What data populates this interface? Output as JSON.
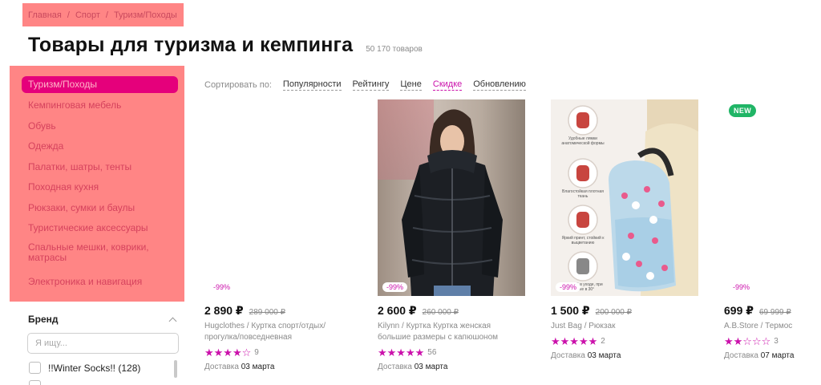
{
  "breadcrumb": {
    "items": [
      "Главная",
      "Спорт",
      "Туризм/Походы"
    ],
    "separator": "/"
  },
  "title": "Товары для туризма и кемпинга",
  "count": "50 170 товаров",
  "sidebar": {
    "categories": [
      "Туризм/Походы",
      "Кемпинговая мебель",
      "Обувь",
      "Одежда",
      "Палатки, шатры, тенты",
      "Походная кухня",
      "Рюкзаки, сумки и баулы",
      "Туристические аксессуары",
      "Спальные мешки, коврики, матрасы",
      "Электроника и навигация"
    ]
  },
  "brand_filter": {
    "title": "Бренд",
    "placeholder": "Я ищу...",
    "items": [
      "!!Winter Socks!! (128)"
    ]
  },
  "sort": {
    "label": "Сортировать по:",
    "options": [
      "Популярности",
      "Рейтингу",
      "Цене",
      "Скидке",
      "Обновлению"
    ],
    "active": "Скидке"
  },
  "products": [
    {
      "discount": "-99%",
      "price": "2 890 ₽",
      "old_price": "289 000 ₽",
      "brand": "Hugclothes",
      "name": "Куртка спорт/отдых/прогулка/повседневная",
      "rating": 4,
      "reviews": "9",
      "delivery_label": "Доставка",
      "delivery_date": "03 марта"
    },
    {
      "discount": "-99%",
      "price": "2 600 ₽",
      "old_price": "260 000 ₽",
      "brand": "Kilynn",
      "name": "Куртка Куртка женская большие размеры с капюшоном",
      "rating": 5,
      "reviews": "56",
      "delivery_label": "Доставка",
      "delivery_date": "03 марта"
    },
    {
      "discount": "-99%",
      "price": "1 500 ₽",
      "old_price": "200 000 ₽",
      "brand": "Just Bag",
      "name": "Рюкзак",
      "rating": 5,
      "reviews": "2",
      "delivery_label": "Доставка",
      "delivery_date": "03 марта"
    },
    {
      "discount": "-99%",
      "price": "699 ₽",
      "old_price": "69 999 ₽",
      "brand": "A.B.Store",
      "name": "Термос",
      "rating": 2,
      "reviews": "3",
      "delivery_label": "Доставка",
      "delivery_date": "07 марта",
      "badge": "NEW"
    }
  ],
  "backpack_features": [
    "Удобные лямки анатомической формы",
    "Влагостойкая плотная ткань",
    "Яркий принт, стойкий к выцветанию",
    "Простой в уходе, при стирке в 30°"
  ],
  "colors": {
    "accent": "#cb11ab",
    "active_category": "#e5007b",
    "overlay": "#ff8585",
    "new_badge": "#20b566"
  }
}
